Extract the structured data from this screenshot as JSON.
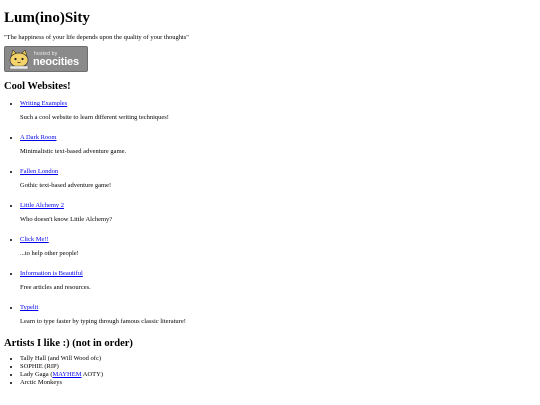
{
  "site": {
    "title": "Lum(ino)Sity",
    "quote": "\"The happiness of your life depends upon the quality of your thoughts\""
  },
  "badge": {
    "hosted_text": "hosted by",
    "brand_text": "neocities",
    "icon": "neocities-cat-icon"
  },
  "cool_websites": {
    "heading": "Cool Websites!",
    "items": [
      {
        "label": "Writing Examples",
        "desc": "Such a cool website to learn different writing techniques!"
      },
      {
        "label": "A Dark Room",
        "desc": "Minimalistic text-based adventure game."
      },
      {
        "label": "Fallen London",
        "desc": "Gothic text-based adventure game!"
      },
      {
        "label": "Little Alchemy 2",
        "desc": "Who doesn't know Little Alchemy?"
      },
      {
        "label": "Click Me!!",
        "desc": "...to help other people!"
      },
      {
        "label": "Information is Beautiful",
        "desc": "Free articles and resources."
      },
      {
        "label": "Typelit",
        "desc": "Learn to type faster by typing through famous classic literature!"
      }
    ]
  },
  "artists": {
    "heading": "Artists I like :) (not in order)",
    "items": [
      {
        "text": "Tally Hall (and Will Wood ofc)"
      },
      {
        "text": "SOPHIE (RIP)"
      },
      {
        "prefix": "Lady Gaga (",
        "link": "MAYHEM",
        "suffix": " AOTY)"
      },
      {
        "text": "Arctic Monkeys"
      }
    ]
  },
  "colors": {
    "link": "#0000ee",
    "badge_bg": "#8a8a8a"
  }
}
